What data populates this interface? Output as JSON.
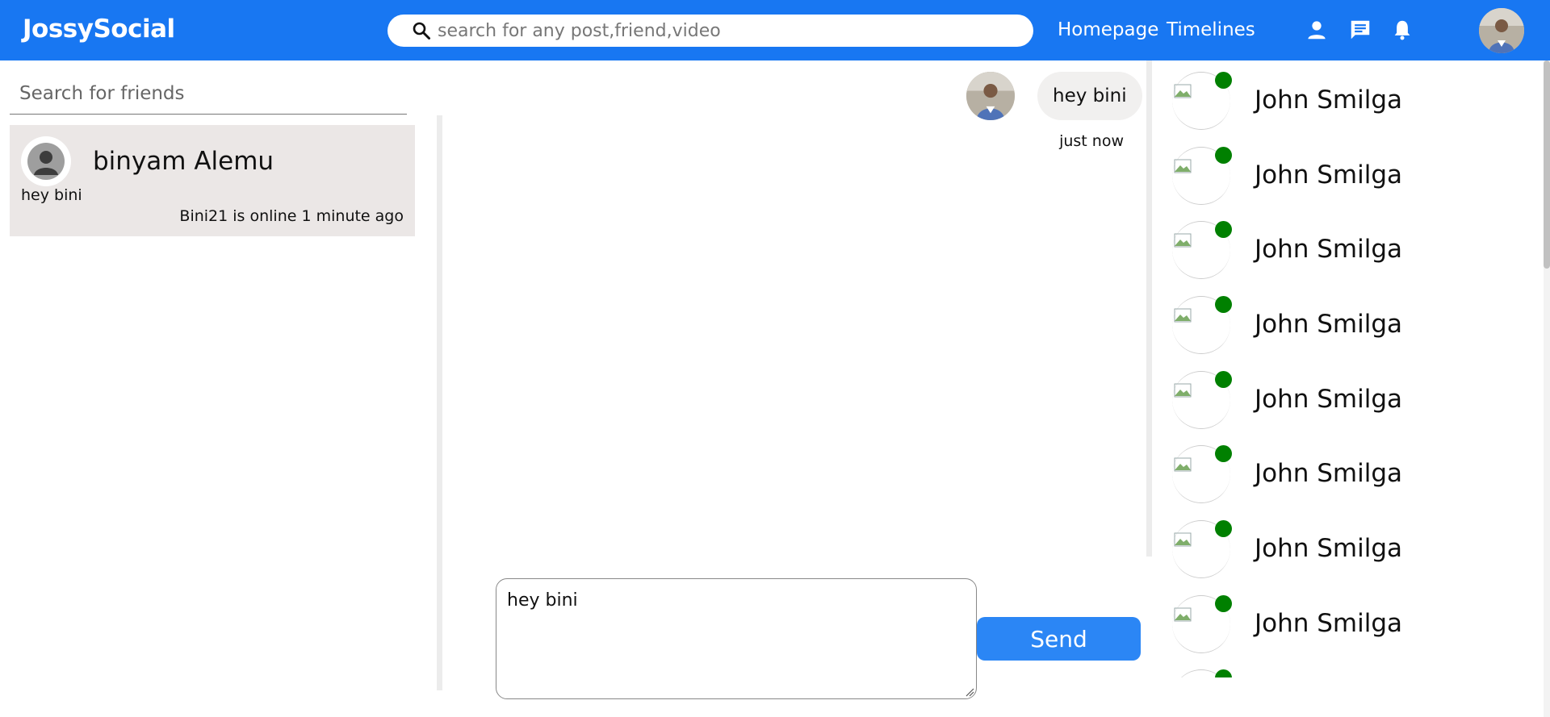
{
  "header": {
    "logo": "JossySocial",
    "search_placeholder": "search for any post,friend,video",
    "nav": [
      "Homepage",
      "Timelines"
    ],
    "icons": [
      "person-icon",
      "chat-icon",
      "bell-icon"
    ],
    "brand_color": "#1877f2"
  },
  "left": {
    "search_placeholder": "Search for friends",
    "conversations": [
      {
        "name": "binyam Alemu",
        "last_message": "hey bini",
        "status": "Bini21 is online 1 minute ago"
      }
    ]
  },
  "chat": {
    "messages": [
      {
        "text": "hey bini",
        "time": "just now"
      }
    ],
    "composer_value": "hey bini",
    "send_label": "Send"
  },
  "online": {
    "dot_color": "#008000",
    "friends": [
      {
        "name": "John Smilga"
      },
      {
        "name": "John Smilga"
      },
      {
        "name": "John Smilga"
      },
      {
        "name": "John Smilga"
      },
      {
        "name": "John Smilga"
      },
      {
        "name": "John Smilga"
      },
      {
        "name": "John Smilga"
      },
      {
        "name": "John Smilga"
      },
      {
        "name": ""
      }
    ]
  }
}
